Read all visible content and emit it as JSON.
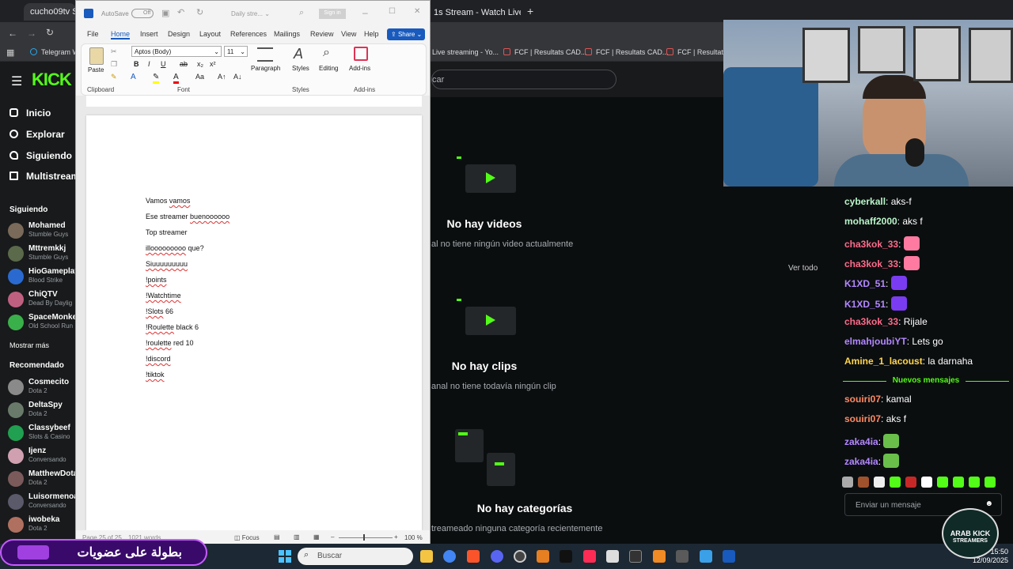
{
  "browser": {
    "tabs": [
      "cucho09tv Str",
      "1s Stream - Watch Live on"
    ],
    "bookmarks": [
      "Telegram W",
      "Live streaming - Yo...",
      "FCF | Resultats CAD...",
      "FCF | Resultats CAD...",
      "FCF | Resultats S"
    ],
    "search_placeholder": "car"
  },
  "kick": {
    "logo": "KICK",
    "nav": [
      "Inicio",
      "Explorar",
      "Siguiendo",
      "Multistream"
    ],
    "following_title": "Siguiendo",
    "following": [
      {
        "name": "Mohamed",
        "game": "Stumble Guys",
        "color": "#7a6a5a"
      },
      {
        "name": "Mttremkkj",
        "game": "Stumble Guys",
        "color": "#5a6a4a"
      },
      {
        "name": "HioGameplay",
        "game": "Blood Strike",
        "color": "#2a6ad0"
      },
      {
        "name": "ChiQTV",
        "game": "Dead By Daylig",
        "color": "#c06080"
      },
      {
        "name": "SpaceMonke",
        "game": "Old School Run",
        "color": "#3ab04a"
      }
    ],
    "show_more": "Mostrar más",
    "recommended_title": "Recomendado",
    "recommended": [
      {
        "name": "Cosmecito",
        "game": "Dota 2",
        "color": "#8a8a8a"
      },
      {
        "name": "DeltaSpy",
        "game": "Dota 2",
        "color": "#6a7a6a"
      },
      {
        "name": "Classybeef",
        "game": "Slots & Casino",
        "color": "#20a050"
      },
      {
        "name": "Ijenz",
        "game": "Conversando",
        "color": "#d0a0b0"
      },
      {
        "name": "MatthewDota",
        "game": "Dota 2",
        "color": "#7a5a5a"
      },
      {
        "name": "Luisormenoa",
        "game": "Conversando",
        "color": "#5a5a6a"
      },
      {
        "name": "iwobeka",
        "game": "Dota 2",
        "color": "#b07060"
      }
    ],
    "videos_title": "No hay videos",
    "videos_sub": "al no tiene ningún video actualmente",
    "clips_title": "No hay clips",
    "clips_sub": "anal no tiene todavía ningún clip",
    "cats_title": "No hay categorías",
    "cats_sub": "treameado ninguna categoría recientemente",
    "see_all": "Ver todo"
  },
  "chat": {
    "messages": [
      {
        "user": "cyberkall",
        "text": "aks-f",
        "color": "#b9f6ca",
        "emote": ""
      },
      {
        "user": "mohaff2000",
        "text": "aks f",
        "color": "#b9f6ca",
        "emote": ""
      },
      {
        "user": "cha3kok_33",
        "text": "",
        "color": "#ff6b8b",
        "emote": "#ff7aa0"
      },
      {
        "user": "cha3kok_33",
        "text": "",
        "color": "#ff6b8b",
        "emote": "#ff7aa0"
      },
      {
        "user": "K1XD_51",
        "text": "",
        "color": "#b388ff",
        "emote": "#7a3cf0"
      },
      {
        "user": "K1XD_51",
        "text": "",
        "color": "#b388ff",
        "emote": "#7a3cf0"
      },
      {
        "user": "cha3kok_33",
        "text": "Rijale",
        "color": "#ff6b8b",
        "emote": ""
      },
      {
        "user": "elmahjoubiYT",
        "text": "Lets go",
        "color": "#b388ff",
        "emote": ""
      },
      {
        "user": "Amine_1_lacoust",
        "text": "la darnaha",
        "color": "#ffd54f",
        "emote": ""
      }
    ],
    "new_messages_label": "Nuevos mensajes",
    "new_messages": [
      {
        "user": "souiri07",
        "text": "kamal",
        "color": "#ff8a65",
        "emote": ""
      },
      {
        "user": "souiri07",
        "text": "aks f",
        "color": "#ff8a65",
        "emote": ""
      },
      {
        "user": "zaka4ia",
        "text": "",
        "color": "#b388ff",
        "emote": "#6abf4b"
      },
      {
        "user": "zaka4ia",
        "text": "",
        "color": "#b388ff",
        "emote": "#6abf4b"
      }
    ],
    "input_placeholder": "Enviar un mensaje"
  },
  "word": {
    "autosave": "AutoSave",
    "autosave_state": "Off",
    "doc_title": "Daily stre...",
    "sign_in": "Sign in",
    "tabs": [
      "File",
      "Home",
      "Insert",
      "Design",
      "Layout",
      "References",
      "Mailings",
      "Review",
      "View",
      "Help"
    ],
    "share": "Share",
    "paste": "Paste",
    "font_name": "Aptos (Body)",
    "font_size": "11",
    "groups": [
      "Clipboard",
      "Font",
      "Styles",
      "Add-ins"
    ],
    "paragraph": "Paragraph",
    "styles": "Styles",
    "editing": "Editing",
    "addins": "Add-ins",
    "lines": [
      {
        "a": "Vamos ",
        "b": "vamos",
        "c": ""
      },
      {
        "a": "Ese streamer ",
        "b": "buenoooooo",
        "c": ""
      },
      {
        "a": "Top streamer",
        "b": "",
        "c": ""
      },
      {
        "a": "",
        "b": "illooooooooo",
        "c": " que?"
      },
      {
        "a": "",
        "b": "Siuuuuuuuuu",
        "c": ""
      },
      {
        "a": "",
        "b": "!points",
        "c": ""
      },
      {
        "a": "",
        "b": "!Watchtime",
        "c": ""
      },
      {
        "a": "",
        "b": "!Slots",
        "c": " 66"
      },
      {
        "a": "",
        "b": "!Roulette",
        "c": " black 6"
      },
      {
        "a": "",
        "b": "!roulette",
        "c": " red 10"
      },
      {
        "a": "",
        "b": "!discord",
        "c": ""
      },
      {
        "a": "",
        "b": "!tiktok",
        "c": ""
      }
    ],
    "status_page": "Page 25 of 25",
    "status_words": "1021 words",
    "focus": "Focus",
    "zoom": "100 %"
  },
  "taskbar": {
    "search": "Buscar",
    "time": "15:50",
    "date": "12/09/2025"
  },
  "overlay": {
    "banner": "بطولة على عضويات",
    "logo_line1": "ARAB KICK",
    "logo_line2": "STREAMERS"
  }
}
